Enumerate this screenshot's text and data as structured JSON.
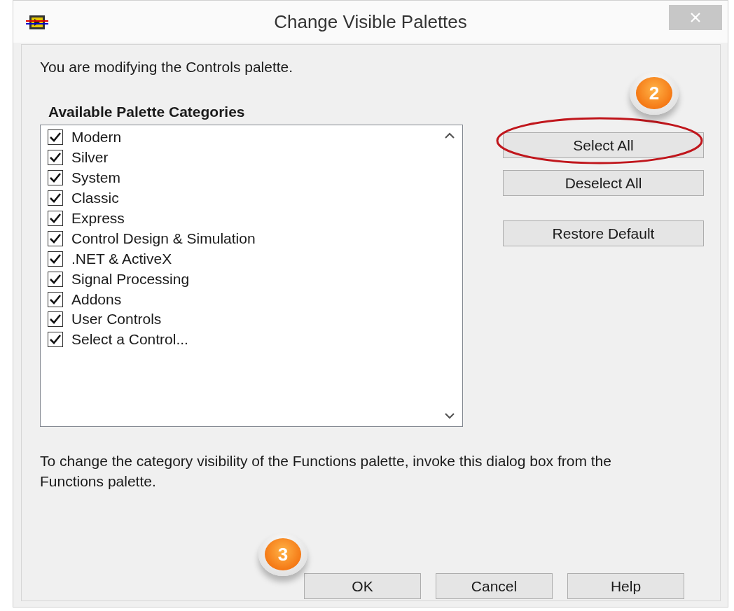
{
  "window": {
    "title": "Change Visible Palettes"
  },
  "intro": "You are modifying the Controls palette.",
  "list": {
    "heading": "Available Palette Categories",
    "items": [
      {
        "label": "Modern",
        "checked": true
      },
      {
        "label": "Silver",
        "checked": true
      },
      {
        "label": "System",
        "checked": true
      },
      {
        "label": "Classic",
        "checked": true
      },
      {
        "label": "Express",
        "checked": true
      },
      {
        "label": "Control Design & Simulation",
        "checked": true
      },
      {
        "label": ".NET & ActiveX",
        "checked": true
      },
      {
        "label": "Signal Processing",
        "checked": true
      },
      {
        "label": "Addons",
        "checked": true
      },
      {
        "label": "User Controls",
        "checked": true
      },
      {
        "label": "Select a Control...",
        "checked": true
      }
    ]
  },
  "side_buttons": [
    {
      "label": "Select All",
      "highlighted": true
    },
    {
      "label": "Deselect All",
      "highlighted": false
    },
    {
      "label": "Restore Default",
      "highlighted": false
    }
  ],
  "note": "To change the category visibility of the Functions palette, invoke this dialog box from the Functions palette.",
  "bottom_buttons": [
    "OK",
    "Cancel",
    "Help"
  ],
  "callouts": [
    {
      "number": "2"
    },
    {
      "number": "3"
    }
  ]
}
